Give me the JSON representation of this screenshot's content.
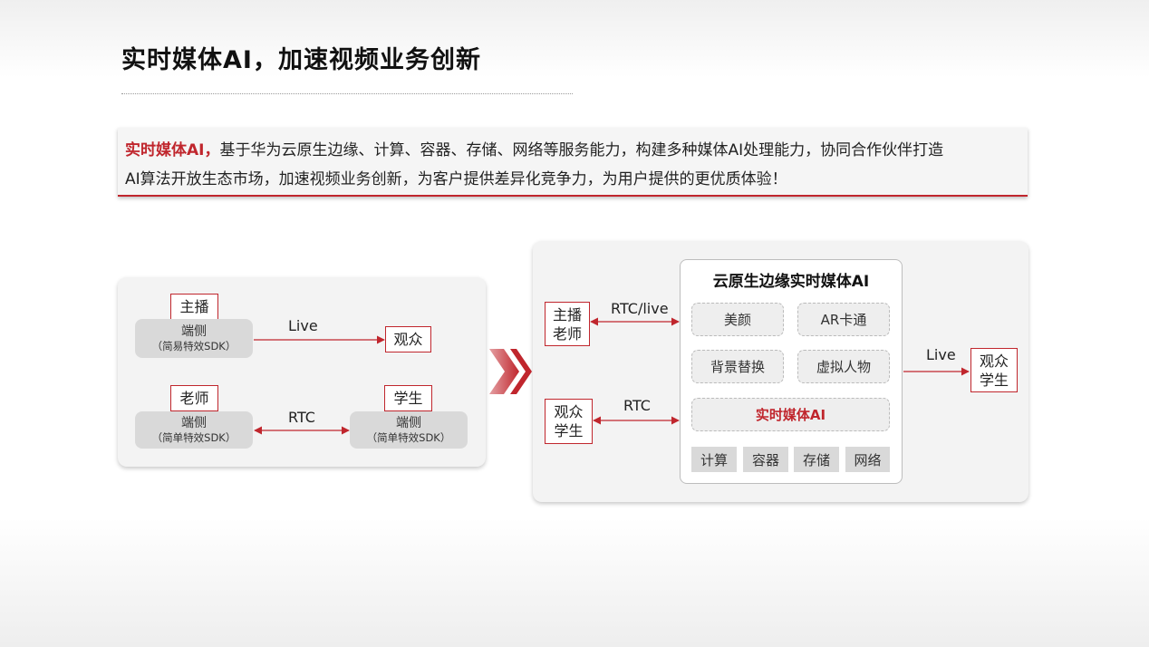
{
  "title": "实时媒体AI，加速视频业务创新",
  "intro": {
    "highlight": "实时媒体AI，",
    "line1": "基于华为云原生边缘、计算、容器、存储、网络等服务能力，构建多种媒体AI处理能力，协同合作伙伴打造",
    "line2": "AI算法开放生态市场，加速视频业务创新，为客户提供差异化竞争力，为用户提供的更优质体验！"
  },
  "left_panel": {
    "host_label": "主播",
    "host_device": {
      "main": "端侧",
      "sub": "（简易特效SDK）"
    },
    "live_label": "Live",
    "audience_label": "观众",
    "teacher_label": "老师",
    "teacher_device": {
      "main": "端侧",
      "sub": "（简单特效SDK）"
    },
    "rtc_label": "RTC",
    "student_label": "学生",
    "student_device": {
      "main": "端侧",
      "sub": "（简单特效SDK）"
    }
  },
  "right_panel": {
    "host_teacher": [
      "主播",
      "老师"
    ],
    "rtc_live_label": "RTC/live",
    "audience_student_left": [
      "观众",
      "学生"
    ],
    "rtc_label": "RTC",
    "cloud": {
      "title": "云原生边缘实时媒体AI",
      "features": [
        "美颜",
        "AR卡通",
        "背景替换",
        "虚拟人物"
      ],
      "core": "实时媒体AI",
      "infra": [
        "计算",
        "容器",
        "存储",
        "网络"
      ]
    },
    "live_label": "Live",
    "audience_student_right": [
      "观众",
      "学生"
    ]
  },
  "colors": {
    "accent": "#c0262d",
    "gray_box": "#d9d9d9",
    "panel": "#f3f3f3"
  }
}
